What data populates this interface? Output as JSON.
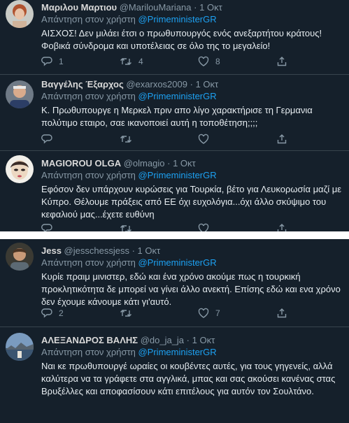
{
  "reply_prefix": "Απάντηση στον χρήστη",
  "colors": {
    "background": "#15202b",
    "text": "#d9d9d9",
    "secondary_text": "#8899a6",
    "mention": "#1da1f2",
    "divider": "#38444d",
    "page_gap": "#ffffff"
  },
  "action_icons": [
    "reply-icon",
    "retweet-icon",
    "like-icon",
    "share-icon"
  ],
  "tweets": [
    {
      "name": "Μαριλου Μαρτιου",
      "handle": "@MarilouMariana",
      "sep": "·",
      "time": "1 Οκτ",
      "mention": "@PrimeministerGR",
      "text": "ΑΙΣΧΟΣ! Δεν μιλάει έτσι ο πρωθυπουργός ενός ανεξαρτήτου κράτους! Φοβικά σύνδρομα και υποτέλειας σε όλο της το μεγαλείο!",
      "replies": "1",
      "retweets": "4",
      "likes": "8"
    },
    {
      "name": "Βαγγέλης Έξαρχος",
      "handle": "@exarxos2009",
      "sep": "·",
      "time": "1 Οκτ",
      "mention": "@PrimeministerGR",
      "text": "Κ. Πρωθυπουργε η Μερκελ πριν απο λίγο χαρακτήρισε τη Γερμανια πολύτιμο εταιρο, σαε ικανοποιεί αυτή η τοποθέτηση;;;;",
      "replies": "",
      "retweets": "",
      "likes": ""
    },
    {
      "name": "MAGIOROU OLGA",
      "handle": "@olmagio",
      "sep": "·",
      "time": "1 Οκτ",
      "mention": "@PrimeministerGR",
      "text": "Εφόσον δεν υπάρχουν κυρώσεις για Τουρκία, βέτο για Λευκορωσία μαζί με Κύπρο. Θέλουμε πράξεις από ΕΕ όχι ευχολόγια...όχι άλλο σκύψιμο του κεφαλιού μας...έχετε ευθύνη",
      "replies": "",
      "retweets": "",
      "likes": ""
    },
    {
      "name": "Jess",
      "handle": "@jesschessjess",
      "sep": "·",
      "time": "1 Οκτ",
      "mention": "@PrimeministerGR",
      "text": "Κυρίε πραιμ μινιστερ, εδώ και ένα χρόνο ακούμε πως η τουρκική προκλητικότητα δε μπορεί να γίνει άλλο ανεκτή. Επίσης εδώ και ενα χρόνο δεν έχουμε κάνουμε κάτι γι'αυτό.",
      "replies": "2",
      "retweets": "",
      "likes": "7"
    },
    {
      "name": "ΑΛΕΞΑΝΔΡΟΣ ΒΑΛΗΣ",
      "handle": "@do_ja_ja",
      "sep": "·",
      "time": "1 Οκτ",
      "mention": "@PrimeministerGR",
      "text": "Ναι κε πρωθυπουργέ ωραίες οι κουβέντες αυτές, για τους γηγενείς, αλλά καλύτερα να τα γράφετε στα αγγλικά, μπας και σας ακούσει κανένας στας Βρυξέλλες και αποφασίσουν κάτι επιτέλους για αυτόν τον Σουλτάνο.",
      "replies": "",
      "retweets": "",
      "likes": ""
    }
  ]
}
